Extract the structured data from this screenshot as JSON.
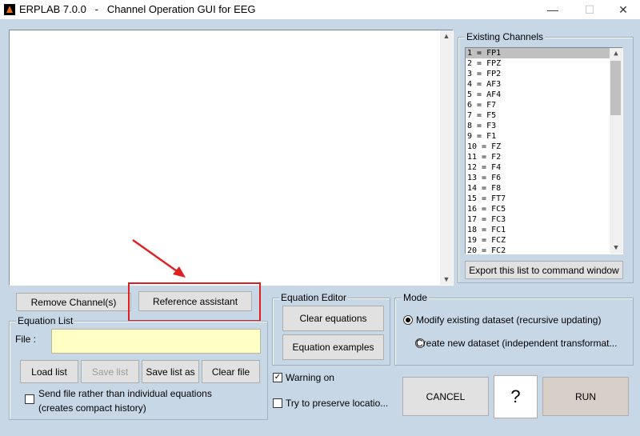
{
  "window": {
    "title": "ERPLAB 7.0.0   -   Channel Operation GUI for EEG",
    "minimize_glyph": "—",
    "maximize_glyph": "☐",
    "close_glyph": "✕"
  },
  "existing_channels": {
    "title": "Existing Channels",
    "items": [
      "1 = FP1",
      "2 = FPZ",
      "3 = FP2",
      "4 = AF3",
      "5 = AF4",
      "6 = F7",
      "7 = F5",
      "8 = F3",
      "9 = F1",
      "10 = FZ",
      "11 = F2",
      "12 = F4",
      "13 = F6",
      "14 = F8",
      "15 = FT7",
      "16 = FC5",
      "17 = FC3",
      "18 = FC1",
      "19 = FCZ",
      "20 = FC2"
    ],
    "selected_index": 0,
    "export_label": "Export this list to command window"
  },
  "buttons": {
    "remove_channel": "Remove Channel(s)",
    "reference_assistant": "Reference assistant"
  },
  "equation_list": {
    "title": "Equation List",
    "file_label": "File :",
    "file_value": "",
    "load": "Load list",
    "save": "Save list",
    "save_as": "Save list as",
    "clear": "Clear file",
    "send_file_label": "Send file rather than individual equations",
    "send_file_label2": "(creates compact history)",
    "send_file_checked": false
  },
  "equation_editor": {
    "title": "Equation Editor",
    "clear": "Clear equations",
    "examples": "Equation examples",
    "warning_label": "Warning on",
    "warning_checked": true,
    "preserve_label": "Try to preserve locatio...",
    "preserve_checked": false
  },
  "mode": {
    "title": "Mode",
    "option1": "Modify existing dataset (recursive updating)",
    "option2": "Create new dataset (independent transformat...",
    "selected": 1
  },
  "actions": {
    "cancel": "CANCEL",
    "help": "?",
    "run": "RUN"
  },
  "annotation": {
    "highlight_color": "#e02020"
  }
}
